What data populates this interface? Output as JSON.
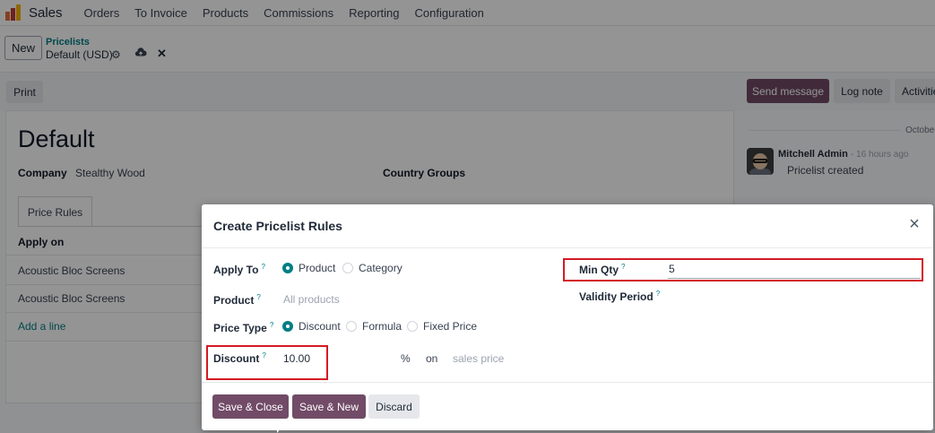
{
  "topbar": {
    "app_name": "Sales",
    "app_icon": "odoo-sales-icon",
    "menu": [
      "Orders",
      "To Invoice",
      "Products",
      "Commissions",
      "Reporting",
      "Configuration"
    ]
  },
  "controlbar": {
    "new_label": "New",
    "breadcrumb_parent": "Pricelists",
    "breadcrumb_current": "Default (USD)",
    "icons": [
      "gear-icon",
      "cloud-upload-icon",
      "discard-icon"
    ]
  },
  "statusbar": {
    "print_label": "Print",
    "send_message_label": "Send message",
    "log_note_label": "Log note",
    "activities_label": "Activities"
  },
  "form": {
    "name": "Default",
    "company_label": "Company",
    "company_value": "Stealthy Wood",
    "country_groups_label": "Country Groups",
    "tab_label": "Price Rules",
    "column_apply_on": "Apply on",
    "rows": [
      "Acoustic Bloc Screens",
      "Acoustic Bloc Screens"
    ],
    "add_line_label": "Add a line"
  },
  "chatter": {
    "date_separator": "October",
    "author": "Mitchell Admin",
    "time": "- 16 hours ago",
    "message": "Pricelist created"
  },
  "modal": {
    "title": "Create Pricelist Rules",
    "help_mark": "?",
    "apply_to": {
      "label": "Apply To",
      "options": [
        "Product",
        "Category"
      ],
      "selected": "Product"
    },
    "product": {
      "label": "Product",
      "placeholder": "All products"
    },
    "price_type": {
      "label": "Price Type",
      "options": [
        "Discount",
        "Formula",
        "Fixed Price"
      ],
      "selected": "Discount"
    },
    "discount": {
      "label": "Discount",
      "value": "10.00",
      "unit": "%",
      "on_label": "on",
      "base_placeholder": "sales price"
    },
    "min_qty": {
      "label": "Min Qty",
      "value": "5"
    },
    "validity_period": {
      "label": "Validity Period"
    },
    "buttons": {
      "save_close": "Save & Close",
      "save_new": "Save & New",
      "discard": "Discard"
    }
  },
  "colors": {
    "primary": "#714b67",
    "accent": "#017e84",
    "highlight": "#d41b25"
  }
}
